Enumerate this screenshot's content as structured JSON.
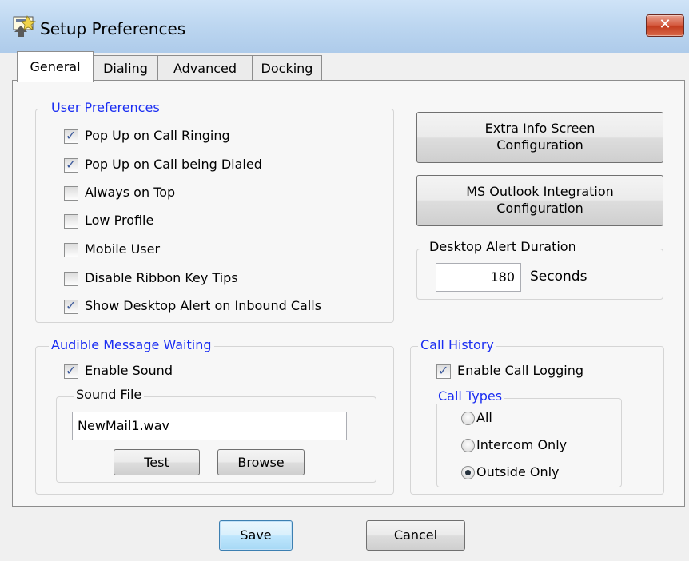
{
  "window": {
    "title": "Setup Preferences",
    "close_label": "✕",
    "app_icon": "setup-preferences-icon"
  },
  "tabs": [
    {
      "label": "General",
      "active": true
    },
    {
      "label": "Dialing",
      "active": false
    },
    {
      "label": "Advanced",
      "active": false
    },
    {
      "label": "Docking",
      "active": false
    }
  ],
  "user_preferences": {
    "legend": "User Preferences",
    "options": [
      {
        "label": "Pop Up on Call Ringing",
        "checked": true
      },
      {
        "label": "Pop Up on Call being Dialed",
        "checked": true
      },
      {
        "label": "Always on Top",
        "checked": false
      },
      {
        "label": "Low Profile",
        "checked": false
      },
      {
        "label": "Mobile User",
        "checked": false
      },
      {
        "label": "Disable Ribbon Key Tips",
        "checked": false
      },
      {
        "label": "Show Desktop Alert on Inbound Calls",
        "checked": true
      }
    ]
  },
  "extra_info_button": {
    "line1": "Extra Info Screen",
    "line2": "Configuration"
  },
  "outlook_button": {
    "line1": "MS Outlook Integration",
    "line2": "Configuration"
  },
  "desktop_alert": {
    "legend": "Desktop Alert Duration",
    "value": "180",
    "unit": "Seconds"
  },
  "audible": {
    "legend": "Audible Message Waiting",
    "enable_sound": {
      "label": "Enable Sound",
      "checked": true
    },
    "sound_file_legend": "Sound File",
    "sound_file_value": "NewMail1.wav",
    "test_label": "Test",
    "browse_label": "Browse"
  },
  "call_history": {
    "legend": "Call History",
    "enable_logging": {
      "label": "Enable Call Logging",
      "checked": true
    },
    "call_types_legend": "Call Types",
    "types": [
      {
        "label": "All",
        "selected": false
      },
      {
        "label": "Intercom Only",
        "selected": false
      },
      {
        "label": "Outside Only",
        "selected": true
      }
    ]
  },
  "footer": {
    "save_label": "Save",
    "cancel_label": "Cancel"
  },
  "colors": {
    "legend_blue": "#1a2df2",
    "title_bar": "#bcd6f0",
    "close_red": "#c23b1e"
  }
}
